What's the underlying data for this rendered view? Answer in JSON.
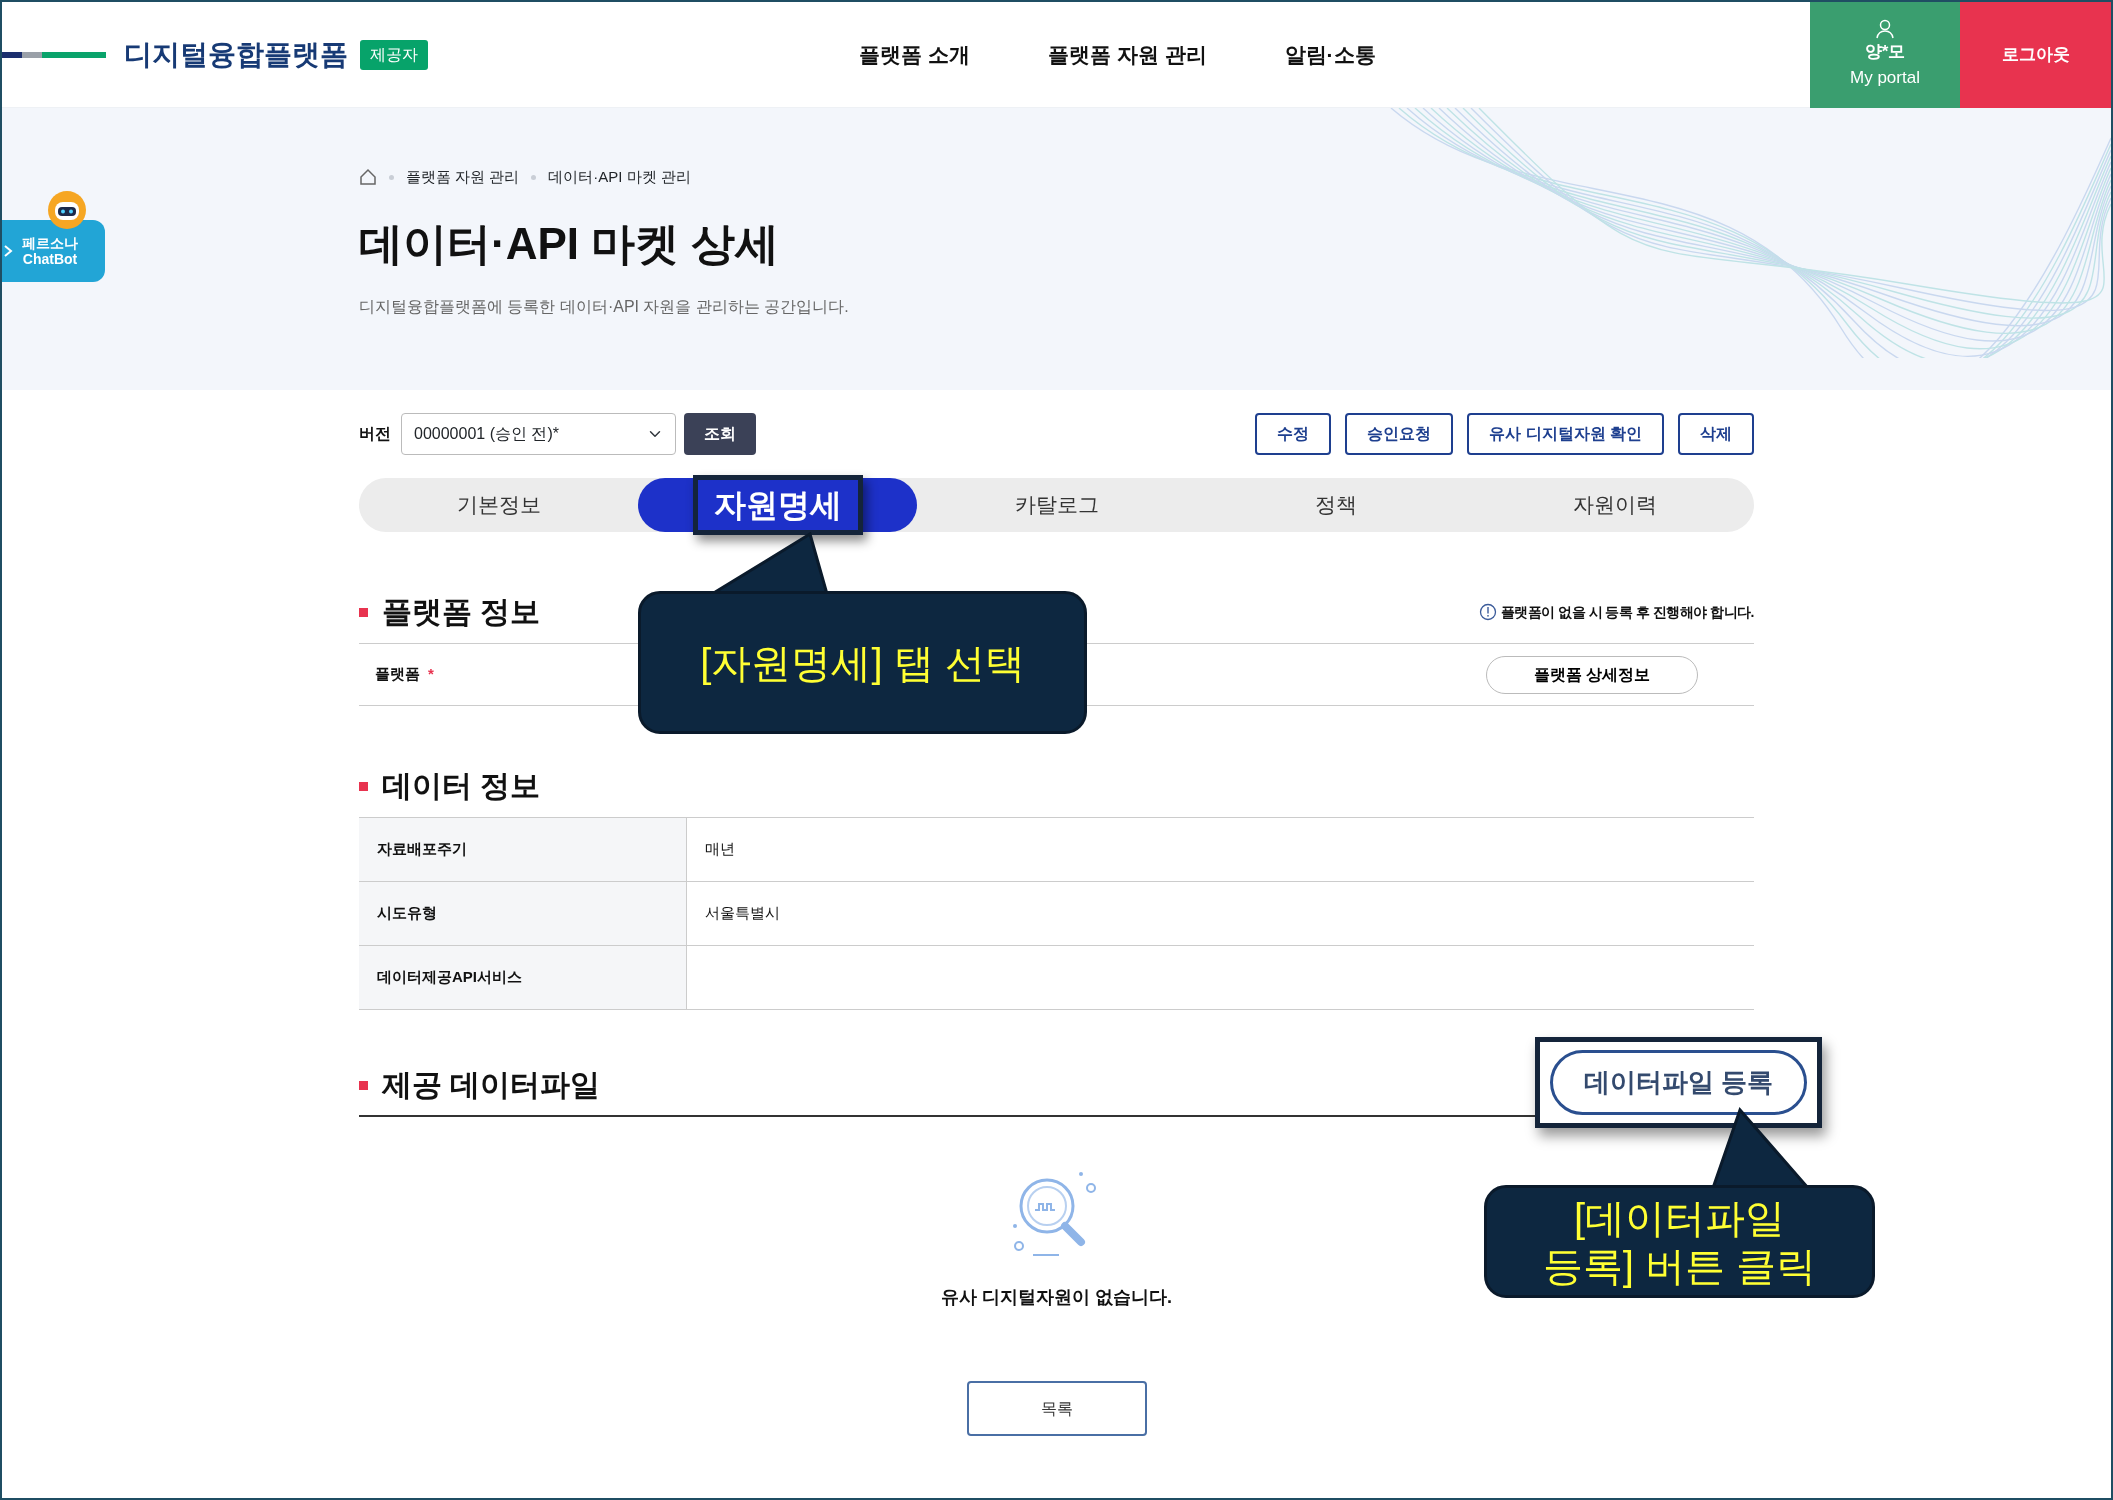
{
  "header": {
    "logo": "디지털융합플랫폼",
    "role_badge": "제공자",
    "nav": [
      "플랫폼 소개",
      "플랫폼 자원 관리",
      "알림·소통"
    ],
    "user": {
      "name": "양*모",
      "portal": "My portal"
    },
    "logout": "로그아웃"
  },
  "chatbot": {
    "lines": [
      "페르소나",
      "ChatBot"
    ]
  },
  "breadcrumb": [
    "플랫폼 자원 관리",
    "데이터·API 마켓 관리"
  ],
  "title": "데이터·API 마켓 상세",
  "description": "디지털융합플랫폼에 등록한 데이터·API 자원을 관리하는 공간입니다.",
  "version": {
    "label": "버전",
    "value": "00000001 (승인 전)*",
    "search_button": "조회"
  },
  "actions": [
    "수정",
    "승인요청",
    "유사 디지털자원 확인",
    "삭제"
  ],
  "tabs": [
    {
      "label": "기본정보",
      "selected": false,
      "highlighted": false
    },
    {
      "label": "자원명세",
      "selected": true,
      "highlighted": true
    },
    {
      "label": "카탈로그",
      "selected": false,
      "highlighted": false
    },
    {
      "label": "정책",
      "selected": false,
      "highlighted": false
    },
    {
      "label": "자원이력",
      "selected": false,
      "highlighted": false
    }
  ],
  "platform_section": {
    "title": "플랫폼 정보",
    "notice": "플랫폼이 없을 시 등록 후 진행해야 합니다.",
    "row": {
      "label": "플랫폼",
      "required_mark": "*",
      "button": "플랫폼 상세정보"
    }
  },
  "data_section": {
    "title": "데이터 정보",
    "rows": [
      {
        "label": "자료배포주기",
        "value": "매년"
      },
      {
        "label": "시도유형",
        "value": "서울특별시"
      },
      {
        "label": "데이터제공API서비스"
      }
    ]
  },
  "file_section": {
    "title": "제공 데이터파일",
    "register_button": {
      "label": "데이터파일 등록",
      "highlighted": true
    },
    "empty_text": "유사 디지털자원이 없습니다."
  },
  "list_button": "목록",
  "callouts": [
    {
      "text": "[자원명세] 탭 선택"
    },
    {
      "text": "[데이터파일\n등록] 버튼 클릭"
    }
  ]
}
